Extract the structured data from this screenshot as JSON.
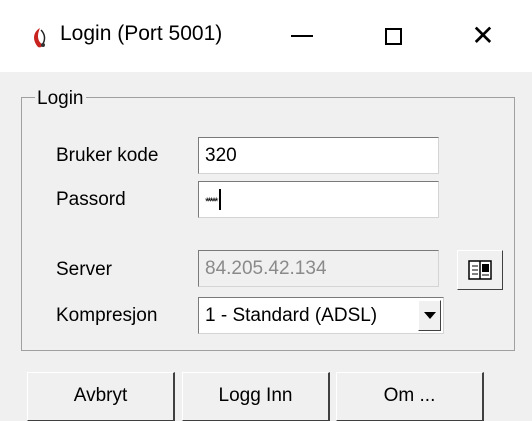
{
  "window": {
    "title": "Login (Port 5001)",
    "close_glyph": "✕"
  },
  "group": {
    "legend": "Login"
  },
  "fields": {
    "user_code": {
      "label": "Bruker kode",
      "value": "320"
    },
    "password": {
      "label": "Passord",
      "masked_value": "*****"
    },
    "server": {
      "label": "Server",
      "value": "84.205.42.134"
    },
    "compression": {
      "label": "Kompresjon",
      "selected": "1 - Standard (ADSL)"
    }
  },
  "buttons": {
    "cancel": "Avbryt",
    "login": "Logg Inn",
    "about": "Om ..."
  },
  "icons": {
    "app": "app-feather-icon",
    "server_book": "address-book-icon"
  }
}
